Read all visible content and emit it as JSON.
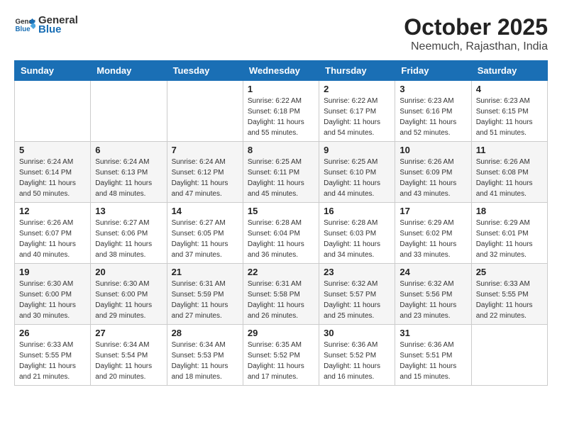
{
  "header": {
    "logo_general": "General",
    "logo_blue": "Blue",
    "month_title": "October 2025",
    "subtitle": "Neemuch, Rajasthan, India"
  },
  "weekdays": [
    "Sunday",
    "Monday",
    "Tuesday",
    "Wednesday",
    "Thursday",
    "Friday",
    "Saturday"
  ],
  "weeks": [
    [
      {
        "day": "",
        "sunrise": "",
        "sunset": "",
        "daylight": ""
      },
      {
        "day": "",
        "sunrise": "",
        "sunset": "",
        "daylight": ""
      },
      {
        "day": "",
        "sunrise": "",
        "sunset": "",
        "daylight": ""
      },
      {
        "day": "1",
        "sunrise": "Sunrise: 6:22 AM",
        "sunset": "Sunset: 6:18 PM",
        "daylight": "Daylight: 11 hours and 55 minutes."
      },
      {
        "day": "2",
        "sunrise": "Sunrise: 6:22 AM",
        "sunset": "Sunset: 6:17 PM",
        "daylight": "Daylight: 11 hours and 54 minutes."
      },
      {
        "day": "3",
        "sunrise": "Sunrise: 6:23 AM",
        "sunset": "Sunset: 6:16 PM",
        "daylight": "Daylight: 11 hours and 52 minutes."
      },
      {
        "day": "4",
        "sunrise": "Sunrise: 6:23 AM",
        "sunset": "Sunset: 6:15 PM",
        "daylight": "Daylight: 11 hours and 51 minutes."
      }
    ],
    [
      {
        "day": "5",
        "sunrise": "Sunrise: 6:24 AM",
        "sunset": "Sunset: 6:14 PM",
        "daylight": "Daylight: 11 hours and 50 minutes."
      },
      {
        "day": "6",
        "sunrise": "Sunrise: 6:24 AM",
        "sunset": "Sunset: 6:13 PM",
        "daylight": "Daylight: 11 hours and 48 minutes."
      },
      {
        "day": "7",
        "sunrise": "Sunrise: 6:24 AM",
        "sunset": "Sunset: 6:12 PM",
        "daylight": "Daylight: 11 hours and 47 minutes."
      },
      {
        "day": "8",
        "sunrise": "Sunrise: 6:25 AM",
        "sunset": "Sunset: 6:11 PM",
        "daylight": "Daylight: 11 hours and 45 minutes."
      },
      {
        "day": "9",
        "sunrise": "Sunrise: 6:25 AM",
        "sunset": "Sunset: 6:10 PM",
        "daylight": "Daylight: 11 hours and 44 minutes."
      },
      {
        "day": "10",
        "sunrise": "Sunrise: 6:26 AM",
        "sunset": "Sunset: 6:09 PM",
        "daylight": "Daylight: 11 hours and 43 minutes."
      },
      {
        "day": "11",
        "sunrise": "Sunrise: 6:26 AM",
        "sunset": "Sunset: 6:08 PM",
        "daylight": "Daylight: 11 hours and 41 minutes."
      }
    ],
    [
      {
        "day": "12",
        "sunrise": "Sunrise: 6:26 AM",
        "sunset": "Sunset: 6:07 PM",
        "daylight": "Daylight: 11 hours and 40 minutes."
      },
      {
        "day": "13",
        "sunrise": "Sunrise: 6:27 AM",
        "sunset": "Sunset: 6:06 PM",
        "daylight": "Daylight: 11 hours and 38 minutes."
      },
      {
        "day": "14",
        "sunrise": "Sunrise: 6:27 AM",
        "sunset": "Sunset: 6:05 PM",
        "daylight": "Daylight: 11 hours and 37 minutes."
      },
      {
        "day": "15",
        "sunrise": "Sunrise: 6:28 AM",
        "sunset": "Sunset: 6:04 PM",
        "daylight": "Daylight: 11 hours and 36 minutes."
      },
      {
        "day": "16",
        "sunrise": "Sunrise: 6:28 AM",
        "sunset": "Sunset: 6:03 PM",
        "daylight": "Daylight: 11 hours and 34 minutes."
      },
      {
        "day": "17",
        "sunrise": "Sunrise: 6:29 AM",
        "sunset": "Sunset: 6:02 PM",
        "daylight": "Daylight: 11 hours and 33 minutes."
      },
      {
        "day": "18",
        "sunrise": "Sunrise: 6:29 AM",
        "sunset": "Sunset: 6:01 PM",
        "daylight": "Daylight: 11 hours and 32 minutes."
      }
    ],
    [
      {
        "day": "19",
        "sunrise": "Sunrise: 6:30 AM",
        "sunset": "Sunset: 6:00 PM",
        "daylight": "Daylight: 11 hours and 30 minutes."
      },
      {
        "day": "20",
        "sunrise": "Sunrise: 6:30 AM",
        "sunset": "Sunset: 6:00 PM",
        "daylight": "Daylight: 11 hours and 29 minutes."
      },
      {
        "day": "21",
        "sunrise": "Sunrise: 6:31 AM",
        "sunset": "Sunset: 5:59 PM",
        "daylight": "Daylight: 11 hours and 27 minutes."
      },
      {
        "day": "22",
        "sunrise": "Sunrise: 6:31 AM",
        "sunset": "Sunset: 5:58 PM",
        "daylight": "Daylight: 11 hours and 26 minutes."
      },
      {
        "day": "23",
        "sunrise": "Sunrise: 6:32 AM",
        "sunset": "Sunset: 5:57 PM",
        "daylight": "Daylight: 11 hours and 25 minutes."
      },
      {
        "day": "24",
        "sunrise": "Sunrise: 6:32 AM",
        "sunset": "Sunset: 5:56 PM",
        "daylight": "Daylight: 11 hours and 23 minutes."
      },
      {
        "day": "25",
        "sunrise": "Sunrise: 6:33 AM",
        "sunset": "Sunset: 5:55 PM",
        "daylight": "Daylight: 11 hours and 22 minutes."
      }
    ],
    [
      {
        "day": "26",
        "sunrise": "Sunrise: 6:33 AM",
        "sunset": "Sunset: 5:55 PM",
        "daylight": "Daylight: 11 hours and 21 minutes."
      },
      {
        "day": "27",
        "sunrise": "Sunrise: 6:34 AM",
        "sunset": "Sunset: 5:54 PM",
        "daylight": "Daylight: 11 hours and 20 minutes."
      },
      {
        "day": "28",
        "sunrise": "Sunrise: 6:34 AM",
        "sunset": "Sunset: 5:53 PM",
        "daylight": "Daylight: 11 hours and 18 minutes."
      },
      {
        "day": "29",
        "sunrise": "Sunrise: 6:35 AM",
        "sunset": "Sunset: 5:52 PM",
        "daylight": "Daylight: 11 hours and 17 minutes."
      },
      {
        "day": "30",
        "sunrise": "Sunrise: 6:36 AM",
        "sunset": "Sunset: 5:52 PM",
        "daylight": "Daylight: 11 hours and 16 minutes."
      },
      {
        "day": "31",
        "sunrise": "Sunrise: 6:36 AM",
        "sunset": "Sunset: 5:51 PM",
        "daylight": "Daylight: 11 hours and 15 minutes."
      },
      {
        "day": "",
        "sunrise": "",
        "sunset": "",
        "daylight": ""
      }
    ]
  ]
}
